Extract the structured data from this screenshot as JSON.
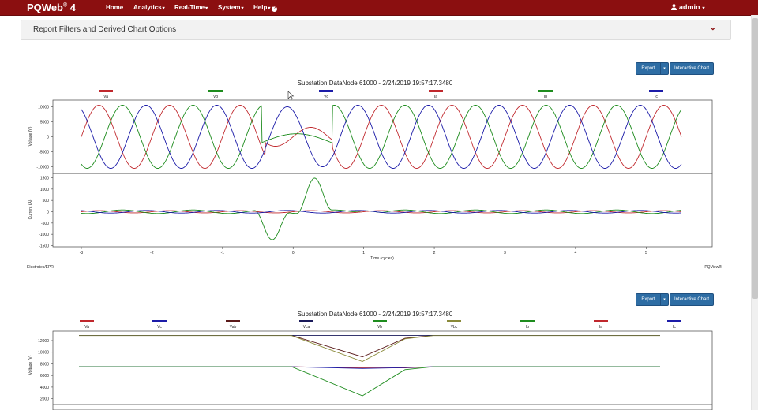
{
  "app": {
    "brand": "PQWeb",
    "brand_sup": "®",
    "brand_version": "4"
  },
  "nav": {
    "items": [
      {
        "label": "Home",
        "caret": false
      },
      {
        "label": "Analytics",
        "caret": true
      },
      {
        "label": "Real-Time",
        "caret": true
      },
      {
        "label": "System",
        "caret": true
      },
      {
        "label": "Help",
        "caret": true
      }
    ],
    "user": "admin"
  },
  "filters": {
    "title": "Report Filters and Derived Chart Options"
  },
  "chart1": {
    "export_label": "Export",
    "interactive_label": "Interactive Chart",
    "title": "Substation DataNode 61000 - 2/24/2019 19:57:17.3480",
    "legend": [
      {
        "name": "Va",
        "color": "#c0282d"
      },
      {
        "name": "Vb",
        "color": "#1e8c1e"
      },
      {
        "name": "Vc",
        "color": "#1c1ca8"
      },
      {
        "name": "Ia",
        "color": "#c0282d"
      },
      {
        "name": "Ib",
        "color": "#1e8c1e"
      },
      {
        "name": "Ic",
        "color": "#1c1ca8"
      }
    ],
    "voltage_ylabel": "Voltage (V)",
    "current_ylabel": "Current (A)",
    "voltage_ticks": [
      "10000",
      "5000",
      "0",
      "-5000",
      "-10000"
    ],
    "current_ticks": [
      "1500",
      "1000",
      "500",
      "0",
      "-500",
      "-1000",
      "-1500"
    ],
    "x_ticks": [
      "-3",
      "-2",
      "-1",
      "0",
      "1",
      "2",
      "3",
      "4",
      "5"
    ],
    "xlabel": "Time (cycles)",
    "footer_left": "Electrotek/EPRI",
    "footer_right": "PQView®"
  },
  "chart2": {
    "export_label": "Export",
    "interactive_label": "Interactive Chart",
    "title": "Substation DataNode 61000 - 2/24/2019 19:57:17.3480",
    "legend": [
      {
        "name": "Va",
        "color": "#c0282d"
      },
      {
        "name": "Vc",
        "color": "#1c1ca8"
      },
      {
        "name": "Vab",
        "color": "#5a1a1a"
      },
      {
        "name": "Vca",
        "color": "#1a1a5a"
      },
      {
        "name": "Vb",
        "color": "#1e8c1e"
      },
      {
        "name": "Vbc",
        "color": "#8a8a3a"
      },
      {
        "name": "Ib",
        "color": "#1e8c1e"
      },
      {
        "name": "Ia",
        "color": "#c0282d"
      },
      {
        "name": "Ic",
        "color": "#1c1ca8"
      }
    ],
    "ylabel": "Voltage (V)",
    "y_ticks": [
      "12000",
      "10000",
      "8000",
      "6000",
      "4000",
      "2000"
    ]
  },
  "chart_data": [
    {
      "type": "line",
      "title": "Substation DataNode 61000 - 2/24/2019 19:57:17.3480",
      "xlabel": "Time (cycles)",
      "ylabel": "Voltage (V)",
      "xlim": [
        -3.0,
        5.5
      ],
      "ylim": [
        -11000,
        11000
      ],
      "series": [
        {
          "name": "Va",
          "color": "#c0282d",
          "amplitude": 10500,
          "phase_deg": 0,
          "sag": {
            "start": -0.4,
            "end": 0.55,
            "residual": 0.3
          }
        },
        {
          "name": "Vb",
          "color": "#1e8c1e",
          "amplitude": 10500,
          "phase_deg": -120,
          "sag": {
            "start": -0.45,
            "end": 0.55,
            "residual": 0.15
          }
        },
        {
          "name": "Vc",
          "color": "#1c1ca8",
          "amplitude": 10500,
          "phase_deg": 120,
          "sag": {
            "start": -0.4,
            "end": 0.55,
            "residual": 0.95
          }
        }
      ]
    },
    {
      "type": "line",
      "title": "",
      "xlabel": "Time (cycles)",
      "ylabel": "Current (A)",
      "xlim": [
        -3.0,
        5.5
      ],
      "ylim": [
        -1600,
        1600
      ],
      "series": [
        {
          "name": "Ia",
          "color": "#c0282d",
          "amplitude": 50,
          "phase_deg": 0,
          "spikes": []
        },
        {
          "name": "Ib",
          "color": "#1e8c1e",
          "amplitude": 80,
          "phase_deg": -120,
          "spikes": [
            {
              "center": -0.3,
              "width": 0.25,
              "peak": -1300
            },
            {
              "center": 0.3,
              "width": 0.25,
              "peak": 1500
            },
            {
              "center": 1.05,
              "width": 0.25,
              "peak": 120
            }
          ]
        },
        {
          "name": "Ic",
          "color": "#1c1ca8",
          "amplitude": 60,
          "phase_deg": 120,
          "spikes": []
        }
      ]
    },
    {
      "type": "line",
      "title": "Substation DataNode 61000 - 2/24/2019 19:57:17.3480",
      "xlabel": "",
      "ylabel": "Voltage (V)",
      "xlim": [
        -3.0,
        5.5
      ],
      "ylim": [
        1000,
        13000
      ],
      "series": [
        {
          "name": "Vab",
          "color": "#5a1a1a",
          "values_x": [
            -3.0,
            0.0,
            1.0,
            1.6,
            2.0,
            5.2
          ],
          "values_y": [
            12900,
            12900,
            9200,
            12400,
            12900,
            12900
          ]
        },
        {
          "name": "Vca",
          "color": "#1a1a5a",
          "values_x": [
            -3.0,
            5.2
          ],
          "values_y": [
            12900,
            12900
          ]
        },
        {
          "name": "Vbc",
          "color": "#8a8a3a",
          "values_x": [
            -3.0,
            0.0,
            1.0,
            1.6,
            2.0,
            5.2
          ],
          "values_y": [
            12850,
            12850,
            8400,
            12300,
            12850,
            12850
          ]
        },
        {
          "name": "Va",
          "color": "#c0282d",
          "values_x": [
            -3.0,
            0.0,
            1.0,
            1.6,
            2.0,
            5.2
          ],
          "values_y": [
            7500,
            7500,
            7300,
            7300,
            7500,
            7500
          ]
        },
        {
          "name": "Vc",
          "color": "#1c1ca8",
          "values_x": [
            -3.0,
            0.0,
            1.0,
            1.6,
            2.0,
            5.2
          ],
          "values_y": [
            7500,
            7500,
            7200,
            7350,
            7500,
            7500
          ]
        },
        {
          "name": "Vb",
          "color": "#1e8c1e",
          "values_x": [
            -3.0,
            0.0,
            1.0,
            1.6,
            2.0,
            5.2
          ],
          "values_y": [
            7500,
            7500,
            2500,
            7000,
            7500,
            7500
          ]
        }
      ]
    }
  ]
}
